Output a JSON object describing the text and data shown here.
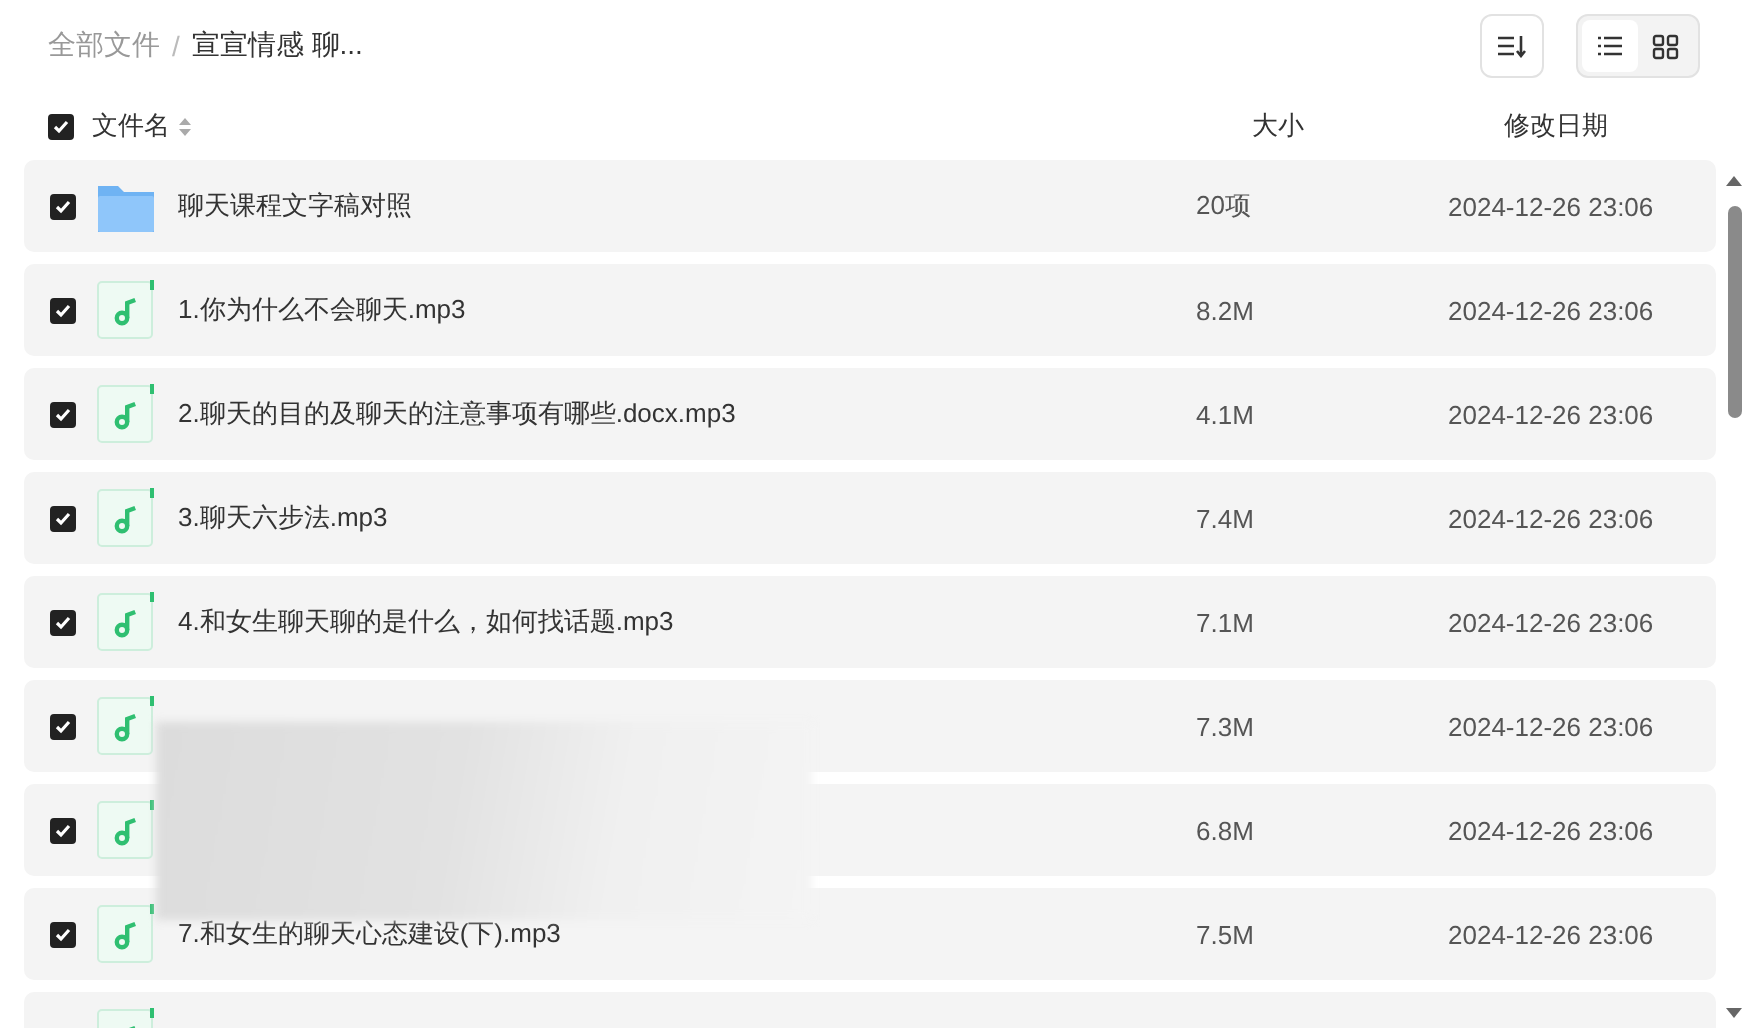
{
  "breadcrumb_separator": "/",
  "breadcrumb": [
    {
      "label": "全部文件",
      "current": false
    },
    {
      "label": "宣宣情感 聊...",
      "current": true
    }
  ],
  "view_modes": [
    {
      "kind": "list",
      "selected": true
    },
    {
      "kind": "grid",
      "selected": false
    }
  ],
  "header": {
    "checked": true,
    "columns": [
      "文件名",
      "大小",
      "修改日期"
    ]
  },
  "rows": [
    {
      "kind": "folder",
      "checked": true,
      "name": "聊天课程文字稿对照",
      "size": "20项",
      "date": "2024-12-26 23:06"
    },
    {
      "kind": "audio",
      "checked": true,
      "name": "1.你为什么不会聊天.mp3",
      "size": "8.2M",
      "date": "2024-12-26 23:06"
    },
    {
      "kind": "audio",
      "checked": true,
      "name": "2.聊天的目的及聊天的注意事项有哪些.docx.mp3",
      "size": "4.1M",
      "date": "2024-12-26 23:06"
    },
    {
      "kind": "audio",
      "checked": true,
      "name": "3.聊天六步法.mp3",
      "size": "7.4M",
      "date": "2024-12-26 23:06"
    },
    {
      "kind": "audio",
      "checked": true,
      "name": "4.和女生聊天聊的是什么，如何找话题.mp3",
      "size": "7.1M",
      "date": "2024-12-26 23:06"
    },
    {
      "kind": "audio",
      "checked": true,
      "size": "7.3M",
      "date": "2024-12-26 23:06"
    },
    {
      "kind": "audio",
      "checked": true,
      "size": "6.8M",
      "date": "2024-12-26 23:06"
    },
    {
      "kind": "audio",
      "checked": true,
      "name": "7.和女生的聊天心态建设(下).mp3",
      "size": "7.5M",
      "date": "2024-12-26 23:06"
    },
    {
      "kind": "audio"
    }
  ]
}
